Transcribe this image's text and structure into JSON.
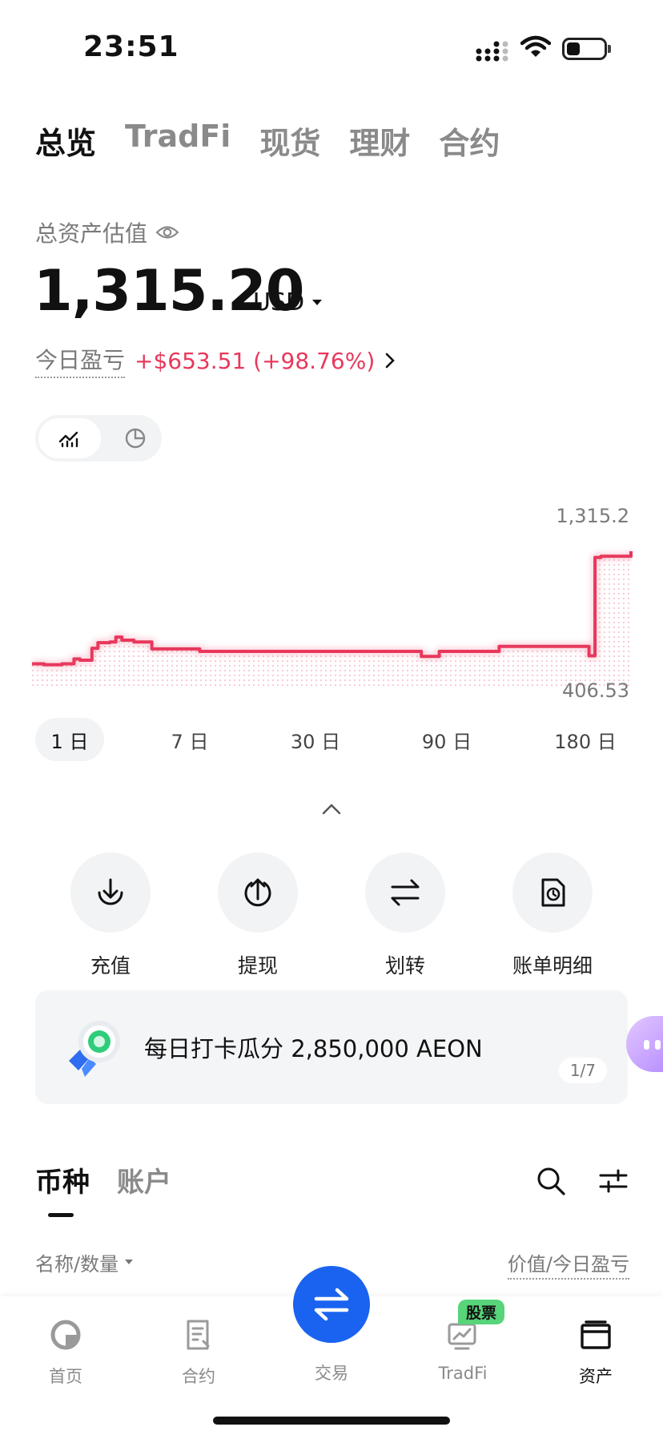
{
  "status_bar": {
    "time": "23:51"
  },
  "top_tabs": [
    "总览",
    "TradFi",
    "现货",
    "理财",
    "合约"
  ],
  "overview": {
    "label": "总资产估值",
    "total_value": "1,315.20",
    "currency": "USD",
    "pnl_label": "今日盈亏",
    "pnl_value": "+$653.51 (+98.76%)"
  },
  "chart": {
    "max_label": "1,315.2",
    "min_label": "406.53",
    "periods": [
      "1 日",
      "7 日",
      "30 日",
      "90 日",
      "180 日"
    ],
    "selected_period": "1 日",
    "line_color": "#e8385c"
  },
  "chart_data": {
    "type": "area",
    "x": [
      0,
      2,
      5,
      7,
      8,
      10,
      11,
      13,
      14,
      15,
      17,
      20,
      28,
      45,
      60,
      65,
      68,
      78,
      90,
      93,
      94,
      95,
      100
    ],
    "values": [
      416,
      409,
      416,
      455,
      445,
      540,
      585,
      590,
      630,
      605,
      590,
      535,
      515,
      515,
      515,
      475,
      515,
      555,
      555,
      480,
      1265,
      1275,
      1315
    ],
    "ylim": [
      406.53,
      1315.2
    ]
  },
  "actions": [
    {
      "label": "充值",
      "icon": "deposit-icon"
    },
    {
      "label": "提现",
      "icon": "withdraw-icon"
    },
    {
      "label": "划转",
      "icon": "transfer-icon"
    },
    {
      "label": "账单明细",
      "icon": "bill-icon"
    }
  ],
  "banner": {
    "text": "每日打卡瓜分 2,850,000 AEON",
    "page": "1/7"
  },
  "list": {
    "tabs": [
      "币种",
      "账户"
    ],
    "col_left": "名称/数量",
    "col_right": "价值/今日盈亏"
  },
  "bottom_nav": {
    "items": [
      "首页",
      "合约",
      "交易",
      "TradFi",
      "资产"
    ],
    "badge": "股票",
    "active": "资产"
  },
  "colors": {
    "accent": "#1a63f0",
    "negative": "#e8385c",
    "badge": "#58d47a"
  }
}
